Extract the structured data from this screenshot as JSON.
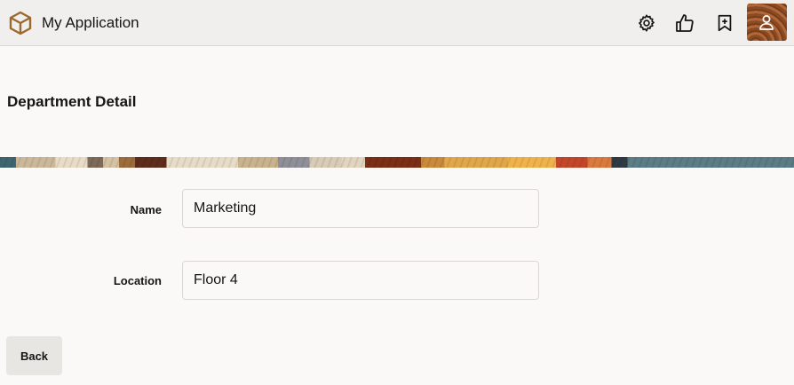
{
  "header": {
    "app_title": "My Application",
    "brand_icon": "box-icon",
    "actions": [
      {
        "name": "settings",
        "icon": "gear-icon"
      },
      {
        "name": "like",
        "icon": "thumbs-up-icon"
      },
      {
        "name": "bookmark",
        "icon": "bookmark-plus-icon"
      },
      {
        "name": "user",
        "icon": "user-icon"
      }
    ],
    "brand_color": "#9a6a2e"
  },
  "page": {
    "title": "Department Detail"
  },
  "form": {
    "name_label": "Name",
    "name_value": "Marketing",
    "location_label": "Location",
    "location_value": "Floor 4"
  },
  "footer": {
    "back_label": "Back"
  }
}
